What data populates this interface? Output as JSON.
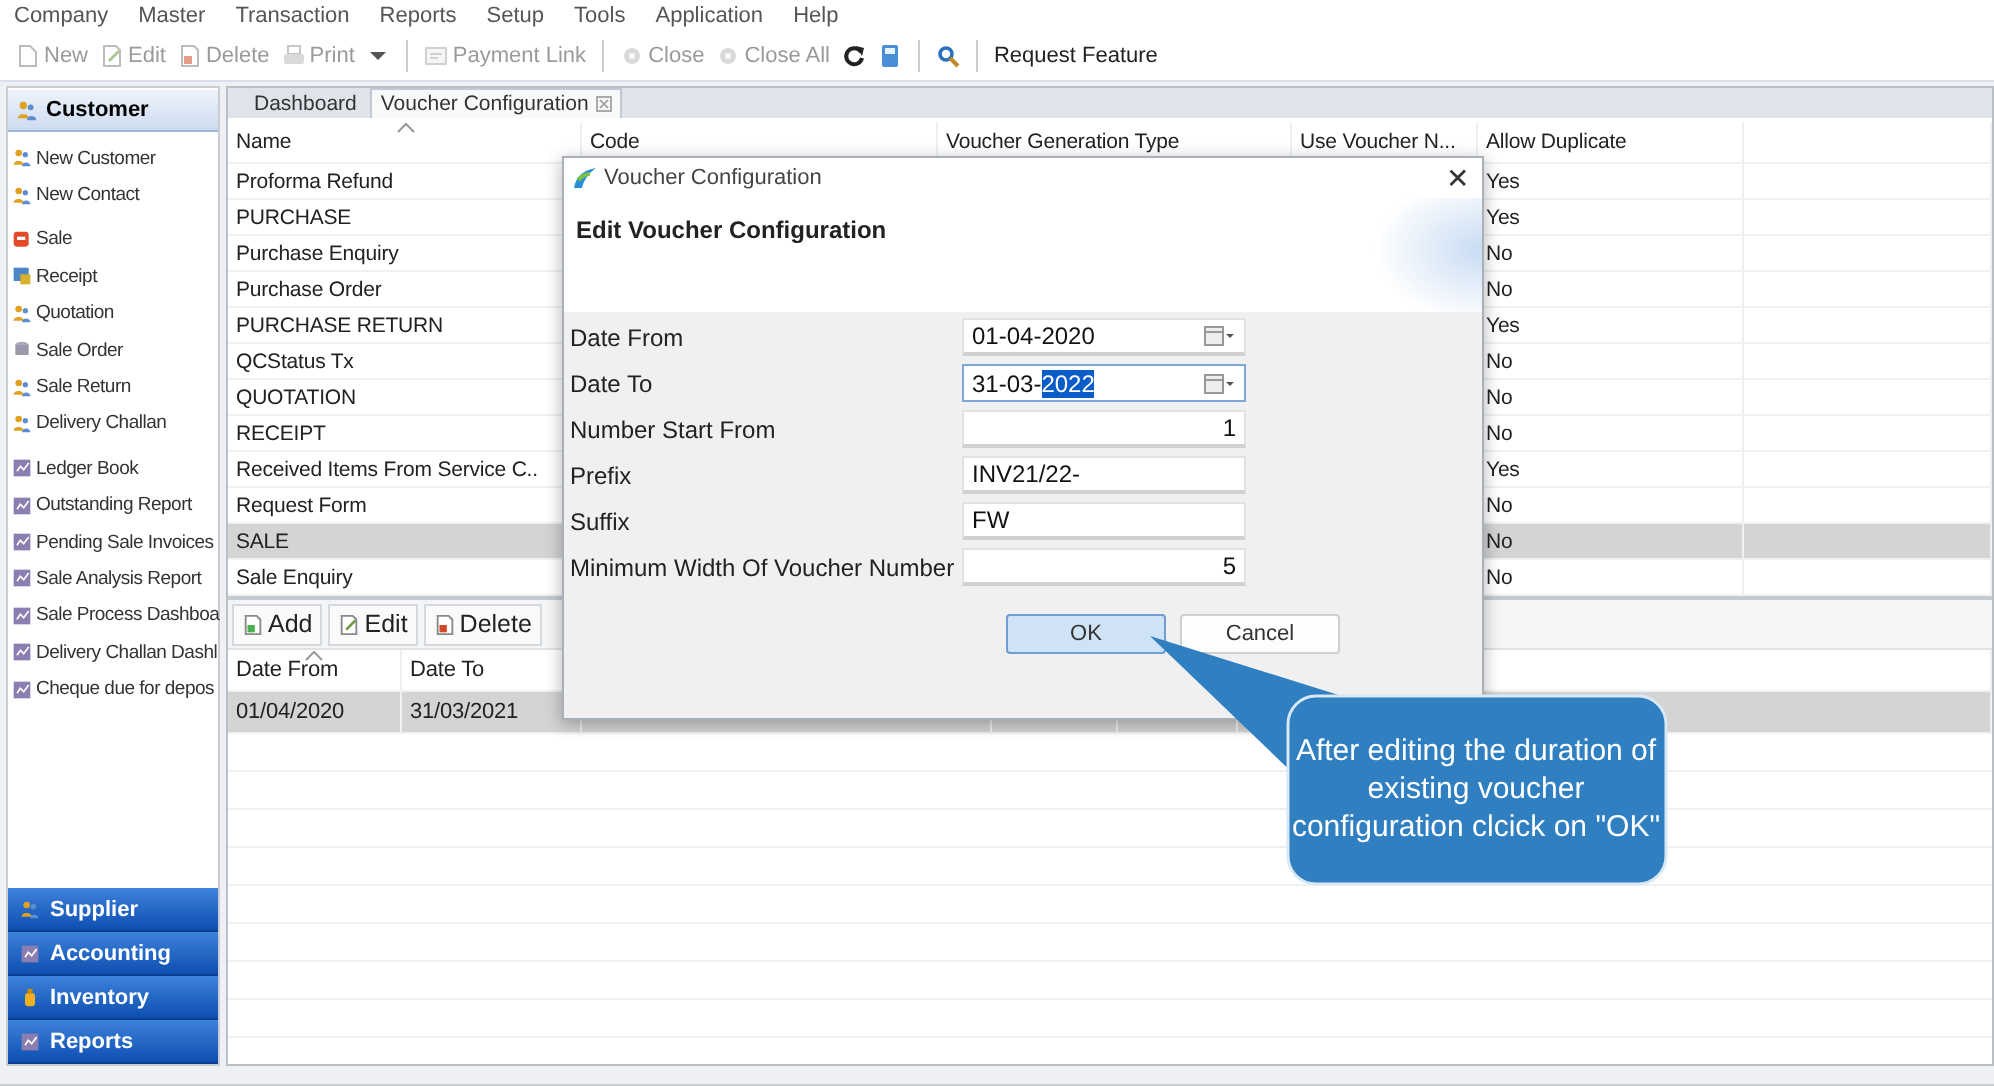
{
  "menu": [
    "Company",
    "Master",
    "Transaction",
    "Reports",
    "Setup",
    "Tools",
    "Application",
    "Help"
  ],
  "toolbar": [
    {
      "kind": "new",
      "label": "New",
      "disabled": true
    },
    {
      "kind": "edit",
      "label": "Edit",
      "disabled": true
    },
    {
      "kind": "delete",
      "label": "Delete",
      "disabled": true
    },
    {
      "kind": "print",
      "label": "Print",
      "disabled": true
    },
    {
      "kind": "dropdown",
      "disabled": false
    },
    {
      "kind": "separator"
    },
    {
      "kind": "link",
      "label": "Payment Link",
      "disabled": true
    },
    {
      "kind": "separator"
    },
    {
      "kind": "close",
      "label": "Close",
      "disabled": true
    },
    {
      "kind": "close",
      "label": "Close All",
      "disabled": true
    },
    {
      "kind": "refresh",
      "disabled": false
    },
    {
      "kind": "calculator",
      "disabled": false
    },
    {
      "kind": "separator"
    },
    {
      "kind": "search",
      "disabled": false
    },
    {
      "kind": "separator"
    },
    {
      "kind": "text",
      "label": "Request Feature",
      "disabled": false
    }
  ],
  "sidebar": {
    "header": {
      "label": "Customer"
    },
    "sections": [
      {
        "items": [
          {
            "kind": "person",
            "label": "New Customer"
          },
          {
            "kind": "person",
            "label": "New Contact"
          }
        ]
      },
      {
        "items": [
          {
            "kind": "sale",
            "label": "Sale"
          },
          {
            "kind": "receipt",
            "label": "Receipt"
          },
          {
            "kind": "person",
            "label": "Quotation"
          },
          {
            "kind": "order",
            "label": "Sale Order"
          },
          {
            "kind": "person",
            "label": "Sale Return"
          },
          {
            "kind": "person",
            "label": "Delivery Challan"
          }
        ]
      },
      {
        "items": [
          {
            "kind": "report",
            "label": "Ledger Book"
          },
          {
            "kind": "report",
            "label": "Outstanding Report"
          },
          {
            "kind": "report",
            "label": "Pending Sale Invoices"
          },
          {
            "kind": "report",
            "label": "Sale Analysis Report"
          },
          {
            "kind": "report",
            "label": "Sale Process Dashboa"
          },
          {
            "kind": "report",
            "label": "Delivery Challan Dashl"
          },
          {
            "kind": "report",
            "label": "Cheque due for depos"
          }
        ]
      }
    ],
    "modules": [
      {
        "kind": "person",
        "label": "Supplier"
      },
      {
        "kind": "report",
        "label": "Accounting"
      },
      {
        "kind": "bottle",
        "label": "Inventory"
      },
      {
        "kind": "report",
        "label": "Reports"
      }
    ]
  },
  "tabs": [
    {
      "label": "Dashboard",
      "selected": false,
      "closable": false
    },
    {
      "label": "Voucher Configuration",
      "selected": true,
      "closable": true
    }
  ],
  "grid": {
    "columns": [
      "Name",
      "Code",
      "Voucher Generation Type",
      "Use Voucher N...",
      "Allow Duplicate"
    ],
    "rows": [
      {
        "name": "Proforma Refund",
        "allow_duplicate": "Yes",
        "selected": false
      },
      {
        "name": "PURCHASE",
        "allow_duplicate": "Yes",
        "selected": false
      },
      {
        "name": "Purchase Enquiry",
        "allow_duplicate": "No",
        "selected": false
      },
      {
        "name": "Purchase Order",
        "allow_duplicate": "No",
        "selected": false
      },
      {
        "name": "PURCHASE RETURN",
        "allow_duplicate": "Yes",
        "selected": false
      },
      {
        "name": "QCStatus Tx",
        "allow_duplicate": "No",
        "selected": false
      },
      {
        "name": "QUOTATION",
        "allow_duplicate": "No",
        "selected": false
      },
      {
        "name": "RECEIPT",
        "allow_duplicate": "No",
        "selected": false
      },
      {
        "name": "Received Items From Service C..",
        "allow_duplicate": "Yes",
        "selected": false
      },
      {
        "name": "Request Form",
        "allow_duplicate": "No",
        "selected": false
      },
      {
        "name": "SALE",
        "allow_duplicate": "No",
        "selected": true
      },
      {
        "name": "Sale Enquiry",
        "allow_duplicate": "No",
        "selected": false
      }
    ]
  },
  "detail_toolbar": [
    {
      "kind": "add",
      "label": "Add"
    },
    {
      "kind": "edit",
      "label": "Edit"
    },
    {
      "kind": "delete",
      "label": "Delete"
    }
  ],
  "periods": {
    "columns": [
      "Date From",
      "Date To"
    ],
    "rows": [
      {
        "date_from": "01/04/2020",
        "date_to": "31/03/2021",
        "selected": true
      }
    ]
  },
  "dialog": {
    "title": "Voucher Configuration",
    "close_glyph": "✕",
    "heading": "Edit Voucher Configuration",
    "fields": [
      {
        "kind": "date",
        "label": "Date From",
        "value": "01-04-2020",
        "focused": false
      },
      {
        "kind": "date",
        "label": "Date To",
        "value": "31-03-",
        "selected_text": "2022",
        "focused": true
      },
      {
        "kind": "number",
        "label": "Number Start From",
        "value": "1",
        "focused": false
      },
      {
        "kind": "text",
        "label": "Prefix",
        "value": "INV21/22-",
        "focused": false
      },
      {
        "kind": "text",
        "label": "Suffix",
        "value": "FW",
        "focused": false
      },
      {
        "kind": "number",
        "label": "Minimum Width Of Voucher Number",
        "value": "5",
        "focused": false
      }
    ],
    "buttons": [
      {
        "label": "OK",
        "default": true
      },
      {
        "label": "Cancel",
        "default": false
      }
    ]
  },
  "callout": {
    "text": "After editing the duration of existing voucher configuration clcick on \"OK\""
  }
}
